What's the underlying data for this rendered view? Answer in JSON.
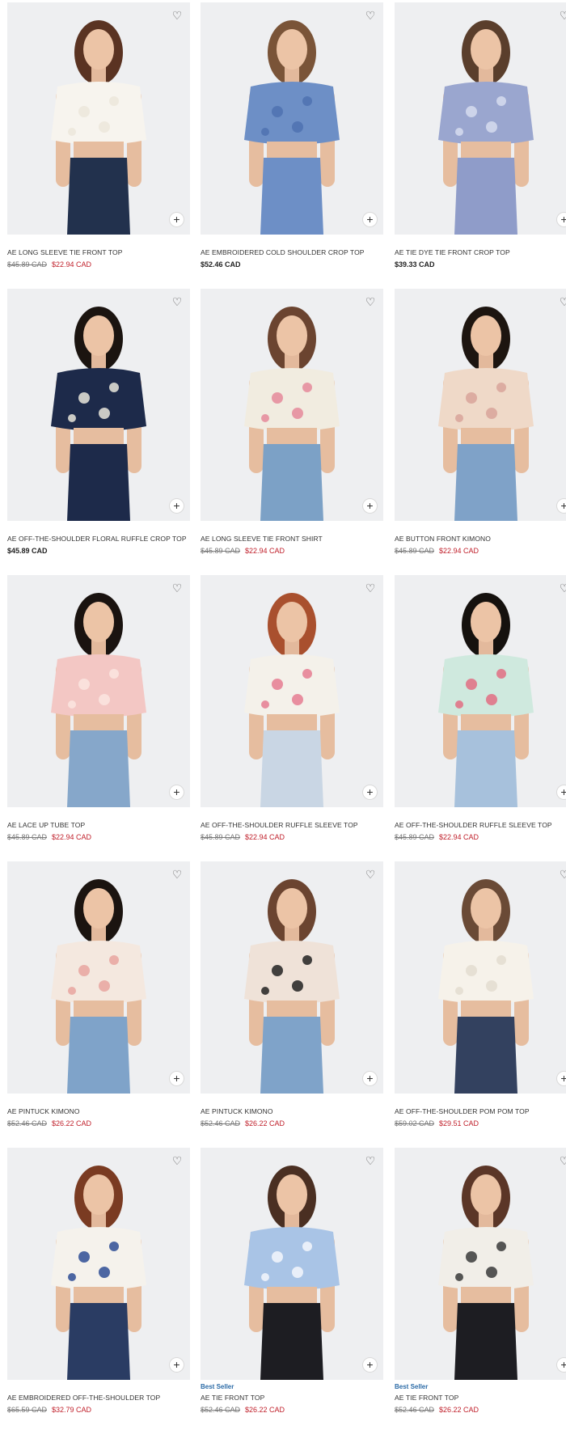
{
  "products": [
    {
      "name": "AE LONG SLEEVE TIE FRONT TOP",
      "badge": "",
      "was": "$45.89 CAD",
      "now": "$22.94 CAD",
      "price": "",
      "figure": "white-top"
    },
    {
      "name": "AE EMBROIDERED COLD SHOULDER CROP TOP",
      "badge": "",
      "was": "",
      "now": "",
      "price": "$52.46 CAD",
      "figure": "blue-romper"
    },
    {
      "name": "AE TIE DYE TIE FRONT CROP TOP",
      "badge": "",
      "was": "",
      "now": "",
      "price": "$39.33 CAD",
      "figure": "tie-dye"
    },
    {
      "name": "AE OFF-THE-SHOULDER FLORAL RUFFLE CROP TOP",
      "badge": "",
      "was": "",
      "now": "",
      "price": "$45.89 CAD",
      "figure": "navy-floral"
    },
    {
      "name": "AE LONG SLEEVE TIE FRONT SHIRT",
      "badge": "",
      "was": "$45.89 CAD",
      "now": "$22.94 CAD",
      "price": "",
      "figure": "floral-shirt"
    },
    {
      "name": "AE BUTTON FRONT KIMONO",
      "badge": "",
      "was": "$45.89 CAD",
      "now": "$22.94 CAD",
      "price": "",
      "figure": "kimono"
    },
    {
      "name": "AE LACE UP TUBE TOP",
      "badge": "",
      "was": "$45.89 CAD",
      "now": "$22.94 CAD",
      "price": "",
      "figure": "pink-tube"
    },
    {
      "name": "AE OFF-THE-SHOULDER RUFFLE SLEEVE TOP",
      "badge": "",
      "was": "$45.89 CAD",
      "now": "$22.94 CAD",
      "price": "",
      "figure": "pink-floral"
    },
    {
      "name": "AE OFF-THE-SHOULDER RUFFLE SLEEVE TOP",
      "badge": "",
      "was": "$45.89 CAD",
      "now": "$22.94 CAD",
      "price": "",
      "figure": "mint-floral"
    },
    {
      "name": "AE PINTUCK KIMONO",
      "badge": "",
      "was": "$52.46 CAD",
      "now": "$26.22 CAD",
      "price": "",
      "figure": "kimono-white"
    },
    {
      "name": "AE PINTUCK KIMONO",
      "badge": "",
      "was": "$52.46 CAD",
      "now": "$26.22 CAD",
      "price": "",
      "figure": "kimono-black"
    },
    {
      "name": "AE OFF-THE-SHOULDER POM POM TOP",
      "badge": "",
      "was": "$59.02 CAD",
      "now": "$29.51 CAD",
      "price": "",
      "figure": "pom-pom"
    },
    {
      "name": "AE EMBROIDERED OFF-THE-SHOULDER TOP",
      "badge": "",
      "was": "$65.59 CAD",
      "now": "$32.79 CAD",
      "price": "",
      "figure": "embroidered"
    },
    {
      "name": "AE TIE FRONT TOP",
      "badge": "Best Seller",
      "was": "$52.46 CAD",
      "now": "$26.22 CAD",
      "price": "",
      "figure": "blue-stripe"
    },
    {
      "name": "AE TIE FRONT TOP",
      "badge": "Best Seller",
      "was": "$52.46 CAD",
      "now": "$26.22 CAD",
      "price": "",
      "figure": "white-stripe"
    }
  ],
  "icons": {
    "heart": "heart-icon",
    "plus": "plus-icon"
  },
  "colors": {
    "sale": "#c0202b",
    "badge": "#2d6ca7",
    "image_bg": "#eeeff1"
  }
}
